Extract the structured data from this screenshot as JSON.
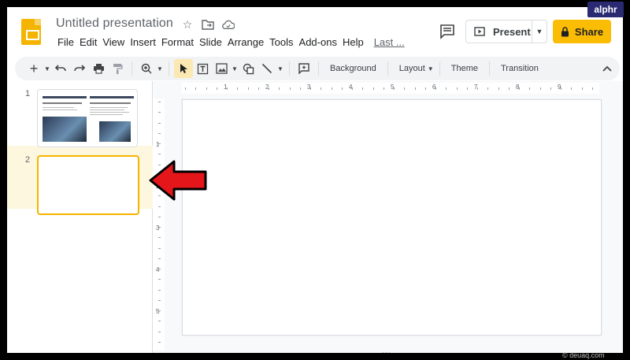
{
  "app": {
    "doc_title": "Untitled presentation",
    "menu": [
      "File",
      "Edit",
      "View",
      "Insert",
      "Format",
      "Slide",
      "Arrange",
      "Tools",
      "Add-ons",
      "Help"
    ],
    "last_edit": "Last ...",
    "present_label": "Present",
    "share_label": "Share",
    "accent_color": "#fbbc04"
  },
  "toolbar": {
    "items": [
      "add-icon",
      "undo-icon",
      "redo-icon",
      "print-icon",
      "paint-format-icon",
      "zoom-icon",
      "select-icon",
      "textbox-icon",
      "image-icon",
      "shape-icon",
      "line-icon",
      "new-comment-icon"
    ],
    "background_label": "Background",
    "layout_label": "Layout",
    "theme_label": "Theme",
    "transition_label": "Transition"
  },
  "filmstrip": {
    "slides": [
      {
        "number": "1"
      },
      {
        "number": "2"
      }
    ]
  },
  "rulers": {
    "top": [
      "1",
      "2",
      "3",
      "4",
      "5",
      "6",
      "7",
      "8",
      "9"
    ],
    "left": [
      "1",
      "2",
      "3",
      "4",
      "5"
    ]
  },
  "watermark": "alphr",
  "site_mark": "© deuaq.com"
}
